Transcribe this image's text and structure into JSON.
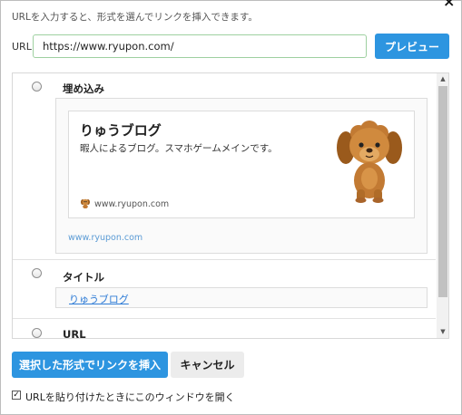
{
  "dialog": {
    "close_label": "×",
    "instruction": "URLを入力すると、形式を選んでリンクを挿入できます。",
    "url_label": "URL",
    "url_value": "https://www.ryupon.com/",
    "preview_button": "プレビュー"
  },
  "options": [
    {
      "id": "embed",
      "label": "埋め込み",
      "card": {
        "title": "りゅうブログ",
        "description": "暇人によるブログ。スマホゲームメインです。",
        "domain": "www.ryupon.com",
        "image_icon": "dog-icon",
        "favicon_icon": "dog-favicon-icon"
      },
      "url_text": "www.ryupon.com"
    },
    {
      "id": "title",
      "label": "タイトル",
      "link_text": "りゅうブログ"
    },
    {
      "id": "url",
      "label": "URL"
    }
  ],
  "footer": {
    "insert_button": "選択した形式でリンクを挿入",
    "cancel_button": "キャンセル",
    "checkbox_checked": true,
    "checkbox_label": "URLを貼り付けたときにこのウィンドウを開く"
  },
  "colors": {
    "accent": "#2d95e0",
    "link": "#2d7bd6",
    "input_border": "#9ed0a0"
  }
}
